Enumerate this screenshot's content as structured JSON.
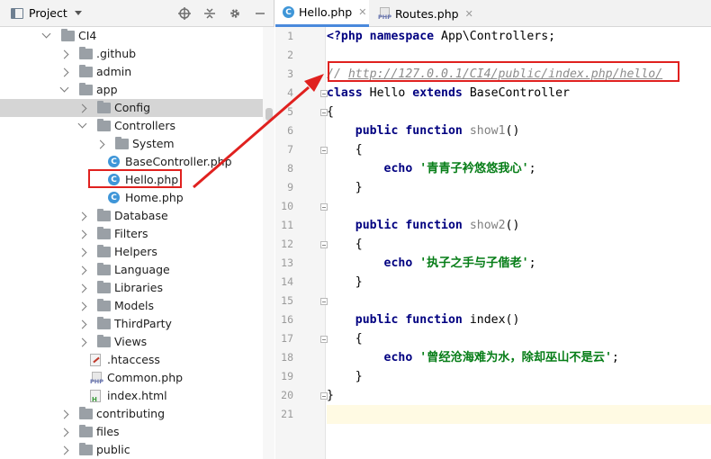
{
  "project_panel": {
    "title": "Project",
    "tools": [
      "crosshair-icon",
      "collapse-icon",
      "gear-icon",
      "minimize-icon"
    ]
  },
  "tree": [
    {
      "label": "CI4",
      "type": "folder",
      "level": 0,
      "state": "expanded"
    },
    {
      "label": ".github",
      "type": "folder",
      "level": 1,
      "state": "collapsed"
    },
    {
      "label": "admin",
      "type": "folder",
      "level": 1,
      "state": "collapsed"
    },
    {
      "label": "app",
      "type": "folder",
      "level": 1,
      "state": "expanded"
    },
    {
      "label": "Config",
      "type": "folder",
      "level": 2,
      "state": "collapsed",
      "selected": true
    },
    {
      "label": "Controllers",
      "type": "folder",
      "level": 2,
      "state": "expanded"
    },
    {
      "label": "System",
      "type": "folder",
      "level": 3,
      "state": "collapsed"
    },
    {
      "label": "BaseController.php",
      "type": "class",
      "level": 3
    },
    {
      "label": "Hello.php",
      "type": "class",
      "level": 3,
      "highlighted": true
    },
    {
      "label": "Home.php",
      "type": "class",
      "level": 3
    },
    {
      "label": "Database",
      "type": "folder",
      "level": 2,
      "state": "collapsed"
    },
    {
      "label": "Filters",
      "type": "folder",
      "level": 2,
      "state": "collapsed"
    },
    {
      "label": "Helpers",
      "type": "folder",
      "level": 2,
      "state": "collapsed"
    },
    {
      "label": "Language",
      "type": "folder",
      "level": 2,
      "state": "collapsed"
    },
    {
      "label": "Libraries",
      "type": "folder",
      "level": 2,
      "state": "collapsed"
    },
    {
      "label": "Models",
      "type": "folder",
      "level": 2,
      "state": "collapsed"
    },
    {
      "label": "ThirdParty",
      "type": "folder",
      "level": 2,
      "state": "collapsed"
    },
    {
      "label": "Views",
      "type": "folder",
      "level": 2,
      "state": "collapsed"
    },
    {
      "label": ".htaccess",
      "type": "htaccess",
      "level": 2
    },
    {
      "label": "Common.php",
      "type": "php",
      "level": 2
    },
    {
      "label": "index.html",
      "type": "html",
      "level": 2
    },
    {
      "label": "contributing",
      "type": "folder",
      "level": 1,
      "state": "collapsed"
    },
    {
      "label": "files",
      "type": "folder",
      "level": 1,
      "state": "collapsed"
    },
    {
      "label": "public",
      "type": "folder",
      "level": 1,
      "state": "collapsed"
    }
  ],
  "tabs": [
    {
      "label": "Hello.php",
      "icon": "class-icon",
      "active": true,
      "close": "✕"
    },
    {
      "label": "Routes.php",
      "icon": "php-file-icon",
      "active": false,
      "close": "✕"
    }
  ],
  "php_tag": "PHP",
  "class_glyph": "C",
  "code_lines": [
    [
      {
        "t": "<?php ",
        "c": "kw"
      },
      {
        "t": "namespace ",
        "c": "kw"
      },
      {
        "t": "App\\Controllers;",
        "c": "fn"
      }
    ],
    [],
    [
      {
        "t": "// ",
        "c": "cmt"
      },
      {
        "t": "http://127.0.0.1/CI4/public/index.php/hello/",
        "c": "cmt-url"
      }
    ],
    [
      {
        "t": "class ",
        "c": "kw"
      },
      {
        "t": "Hello ",
        "c": "fn"
      },
      {
        "t": "extends ",
        "c": "kw"
      },
      {
        "t": "BaseController",
        "c": "fn"
      }
    ],
    [
      {
        "t": "{",
        "c": "fn"
      }
    ],
    [
      {
        "t": "    public ",
        "c": "kw"
      },
      {
        "t": "function ",
        "c": "kw"
      },
      {
        "t": "show1",
        "c": "fn-unused"
      },
      {
        "t": "()",
        "c": "fn"
      }
    ],
    [
      {
        "t": "    {",
        "c": "fn"
      }
    ],
    [
      {
        "t": "        echo ",
        "c": "kw"
      },
      {
        "t": "'青青子衿悠悠我心'",
        "c": "str"
      },
      {
        "t": ";",
        "c": "fn"
      }
    ],
    [
      {
        "t": "    }",
        "c": "fn"
      }
    ],
    [],
    [
      {
        "t": "    public ",
        "c": "kw"
      },
      {
        "t": "function ",
        "c": "kw"
      },
      {
        "t": "show2",
        "c": "fn-unused"
      },
      {
        "t": "()",
        "c": "fn"
      }
    ],
    [
      {
        "t": "    {",
        "c": "fn"
      }
    ],
    [
      {
        "t": "        echo ",
        "c": "kw"
      },
      {
        "t": "'执子之手与子偕老'",
        "c": "str"
      },
      {
        "t": ";",
        "c": "fn"
      }
    ],
    [
      {
        "t": "    }",
        "c": "fn"
      }
    ],
    [],
    [
      {
        "t": "    public ",
        "c": "kw"
      },
      {
        "t": "function ",
        "c": "kw"
      },
      {
        "t": "index",
        "c": "fn"
      },
      {
        "t": "()",
        "c": "fn"
      }
    ],
    [
      {
        "t": "    {",
        "c": "fn"
      }
    ],
    [
      {
        "t": "        echo ",
        "c": "kw"
      },
      {
        "t": "'曾经沧海难为水，除却巫山不是云'",
        "c": "str"
      },
      {
        "t": ";",
        "c": "fn"
      }
    ],
    [
      {
        "t": "    }",
        "c": "fn"
      }
    ],
    [
      {
        "t": "}",
        "c": "fn"
      }
    ],
    []
  ],
  "caret_line": 21,
  "fold_markers": [
    3,
    4,
    6,
    9,
    11,
    14,
    16,
    19
  ],
  "colors": {
    "highlight_red": "#e0211f",
    "keyword": "#000080",
    "string": "#067d17",
    "comment": "#8c8c8c",
    "selection": "#d5d5d5",
    "class_icon": "#3f96d8"
  }
}
